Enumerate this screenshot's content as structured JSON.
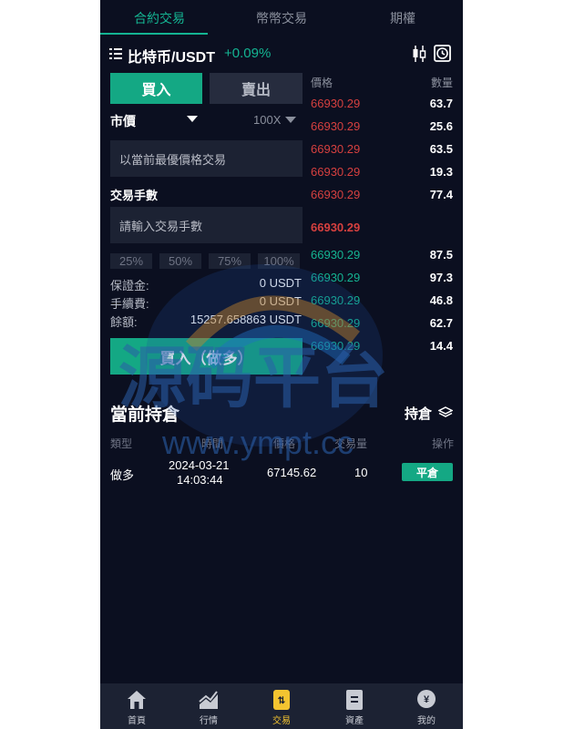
{
  "tabs": [
    {
      "label": "合約交易",
      "active": true
    },
    {
      "label": "幣幣交易",
      "active": false
    },
    {
      "label": "期權",
      "active": false
    }
  ],
  "header": {
    "pair": "比特币/USDT",
    "change": "+0.09%",
    "menu_icon": "menu-list-icon",
    "chart_icon": "candlestick-icon",
    "history_icon": "clock-icon"
  },
  "trade": {
    "buy_label": "買入",
    "sell_label": "賣出",
    "order_type": "市價",
    "leverage": "100X",
    "price_field": "以當前最優價格交易",
    "quantity_label": "交易手數",
    "quantity_placeholder": "請輸入交易手數",
    "percentages": [
      "25%",
      "50%",
      "75%",
      "100%"
    ],
    "margin_label": "保證金:",
    "margin_value": "0 USDT",
    "fee_label": "手續費:",
    "fee_value": "0 USDT",
    "balance_label": "餘額:",
    "balance_value": "15257.658863 USDT",
    "submit_label": "買入（做多）"
  },
  "orderbook": {
    "price_header": "價格",
    "qty_header": "數量",
    "asks": [
      {
        "price": "66930.29",
        "qty": "63.7"
      },
      {
        "price": "66930.29",
        "qty": "25.6"
      },
      {
        "price": "66930.29",
        "qty": "63.5"
      },
      {
        "price": "66930.29",
        "qty": "19.3"
      },
      {
        "price": "66930.29",
        "qty": "77.4"
      }
    ],
    "last_price": "66930.29",
    "bids": [
      {
        "price": "66930.29",
        "qty": "87.5"
      },
      {
        "price": "66930.29",
        "qty": "97.3"
      },
      {
        "price": "66930.29",
        "qty": "46.8"
      },
      {
        "price": "66930.29",
        "qty": "62.7"
      },
      {
        "price": "66930.29",
        "qty": "14.4"
      }
    ]
  },
  "positions": {
    "title": "當前持倉",
    "tab_label": "持倉",
    "tab_icon": "layers-icon",
    "columns": [
      "類型",
      "時間",
      "價格",
      "交易量",
      "操作"
    ],
    "rows": [
      {
        "type": "做多",
        "date": "2024-03-21",
        "time": "14:03:44",
        "price": "67145.62",
        "volume": "10",
        "action": "平倉"
      }
    ]
  },
  "watermark": {
    "text": "源码平台",
    "url": "www.ympt.cc"
  },
  "nav": [
    {
      "label": "首頁",
      "icon": "home-icon",
      "active": false
    },
    {
      "label": "行情",
      "icon": "chart-icon",
      "active": false
    },
    {
      "label": "交易",
      "icon": "trade-icon",
      "active": true
    },
    {
      "label": "資產",
      "icon": "wallet-icon",
      "active": false
    },
    {
      "label": "我的",
      "icon": "user-icon",
      "active": false
    }
  ],
  "colors": {
    "background": "#0b0f20",
    "accent": "#14a884",
    "ask": "#d6403f",
    "bid": "#14b492",
    "nav_active": "#f4c430"
  }
}
